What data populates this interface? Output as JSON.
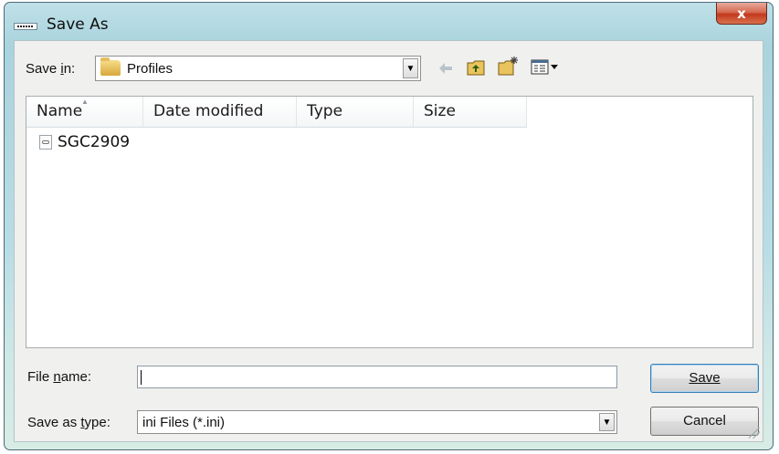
{
  "window": {
    "title": "Save As",
    "close_label": "x"
  },
  "toolbar": {
    "save_in_label": "Save in:",
    "save_in_value": "Profiles",
    "icons": [
      "back-arrow-icon",
      "up-folder-icon",
      "new-folder-icon",
      "view-menu-icon"
    ]
  },
  "list": {
    "columns": [
      "Name",
      "Date modified",
      "Type",
      "Size"
    ],
    "items": [
      {
        "name": "SGC2909",
        "icon": "settings-file-icon"
      }
    ]
  },
  "form": {
    "file_name_label": "File name:",
    "file_name_value": "",
    "save_as_type_label": "Save as type:",
    "save_as_type_value": "ini Files (*.ini)"
  },
  "buttons": {
    "save": "Save",
    "cancel": "Cancel"
  },
  "colors": {
    "close_button": "#c2391c",
    "title_glass": "#a9d3dd"
  }
}
